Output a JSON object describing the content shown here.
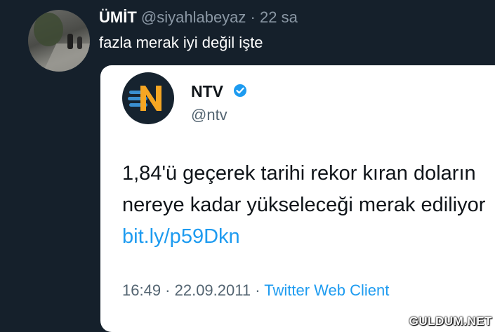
{
  "tweet": {
    "author_name": "ÜMİT",
    "author_handle": "@siyahlabeyaz",
    "separator": "·",
    "time": "22 sa",
    "text": "fazla merak iyi değil işte"
  },
  "quoted": {
    "name": "NTV",
    "handle": "@ntv",
    "text_main": "1,84'ü geçerek tarihi rekor kıran doların nereye kadar yükseleceği merak ediliyor ",
    "link": "bit.ly/p59Dkn",
    "timestamp": "16:49 · 22.09.2011",
    "separator": "·",
    "client": "Twitter Web Client",
    "verified_icon": "verified-badge-icon"
  },
  "watermark": "GULDUM.NET",
  "colors": {
    "background": "#15202b",
    "card": "#ffffff",
    "link": "#1d9bf0",
    "muted": "#8b98a5"
  }
}
